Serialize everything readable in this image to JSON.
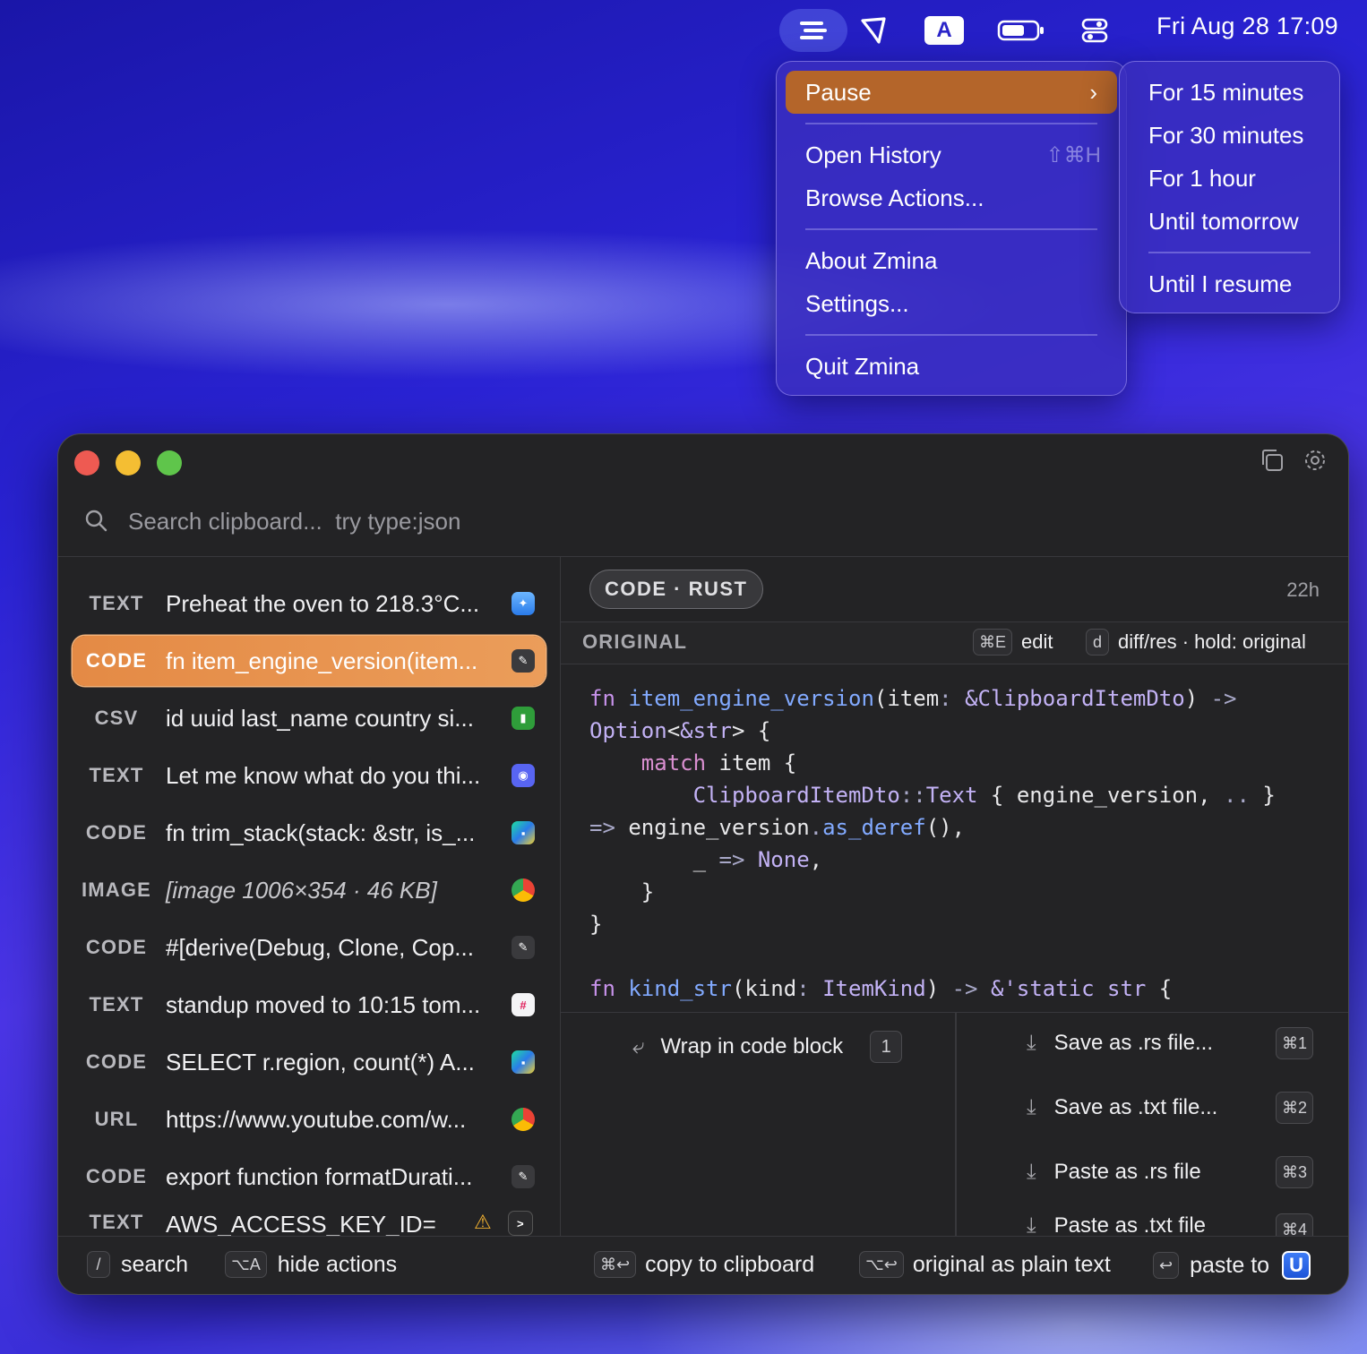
{
  "menubar": {
    "clock": "Fri Aug 28  17:09",
    "input_source": "A"
  },
  "menu": {
    "pause": "Pause",
    "open_history": "Open History",
    "open_history_shortcut": "⇧⌘H",
    "browse_actions": "Browse Actions...",
    "about": "About Zmina",
    "settings": "Settings...",
    "quit": "Quit Zmina"
  },
  "submenu": {
    "items": [
      "For 15 minutes",
      "For 30 minutes",
      "For 1 hour",
      "Until tomorrow"
    ],
    "resume": "Until I resume"
  },
  "search": {
    "placeholder": "Search clipboard...  try type:json"
  },
  "list": {
    "items": [
      {
        "kind": "TEXT",
        "text": "Preheat the oven to 218.3°C...",
        "app": "safari"
      },
      {
        "kind": "CODE",
        "text": "fn item_engine_version(item...",
        "app": "editor"
      },
      {
        "kind": "CSV",
        "text": "id uuid last_name country si...",
        "app": "numbers"
      },
      {
        "kind": "TEXT",
        "text": "Let me know what do you thi...",
        "app": "discord"
      },
      {
        "kind": "CODE",
        "text": "fn trim_stack(stack: &str, is_...",
        "app": "webstorm"
      },
      {
        "kind": "IMAGE",
        "text": "[image 1006×354 · 46 KB]",
        "app": "chrome"
      },
      {
        "kind": "CODE",
        "text": "#[derive(Debug, Clone, Cop...",
        "app": "editor"
      },
      {
        "kind": "TEXT",
        "text": "standup moved to 10:15 tom...",
        "app": "slack"
      },
      {
        "kind": "CODE",
        "text": "SELECT r.region, count(*) A...",
        "app": "webstorm"
      },
      {
        "kind": "URL",
        "text": "https://www.youtube.com/w...",
        "app": "chrome"
      },
      {
        "kind": "CODE",
        "text": "export function formatDurati...",
        "app": "editor"
      },
      {
        "kind": "TEXT",
        "text": "AWS_ACCESS_KEY_ID=",
        "app": "terminal"
      }
    ]
  },
  "detail": {
    "badge": "CODE · RUST",
    "age": "22h",
    "view_label": "ORIGINAL",
    "edit_key": "⌘E",
    "edit_label": "edit",
    "diff_key": "d",
    "diff_label": "diff/res · hold: original"
  },
  "actions": {
    "wrap": "Wrap in code block",
    "wrap_key": "1",
    "right": [
      {
        "label": "Save as .rs file...",
        "key": "⌘1"
      },
      {
        "label": "Save as .txt file...",
        "key": "⌘2"
      },
      {
        "label": "Paste as .rs file",
        "key": "⌘3"
      },
      {
        "label": "Paste as .txt file",
        "key": "⌘4"
      }
    ]
  },
  "bottombar": {
    "search_key": "/",
    "search_label": "search",
    "hide_key": "⌥A",
    "hide_label": "hide actions",
    "copy_key": "⌘↩",
    "copy_label": "copy to clipboard",
    "plain_key": "⌥↩",
    "plain_label": "original as plain text",
    "paste_key": "↩",
    "paste_label": "paste to"
  },
  "colors": {
    "accent": "#e48a45",
    "menu_highlight": "#b4652a"
  }
}
